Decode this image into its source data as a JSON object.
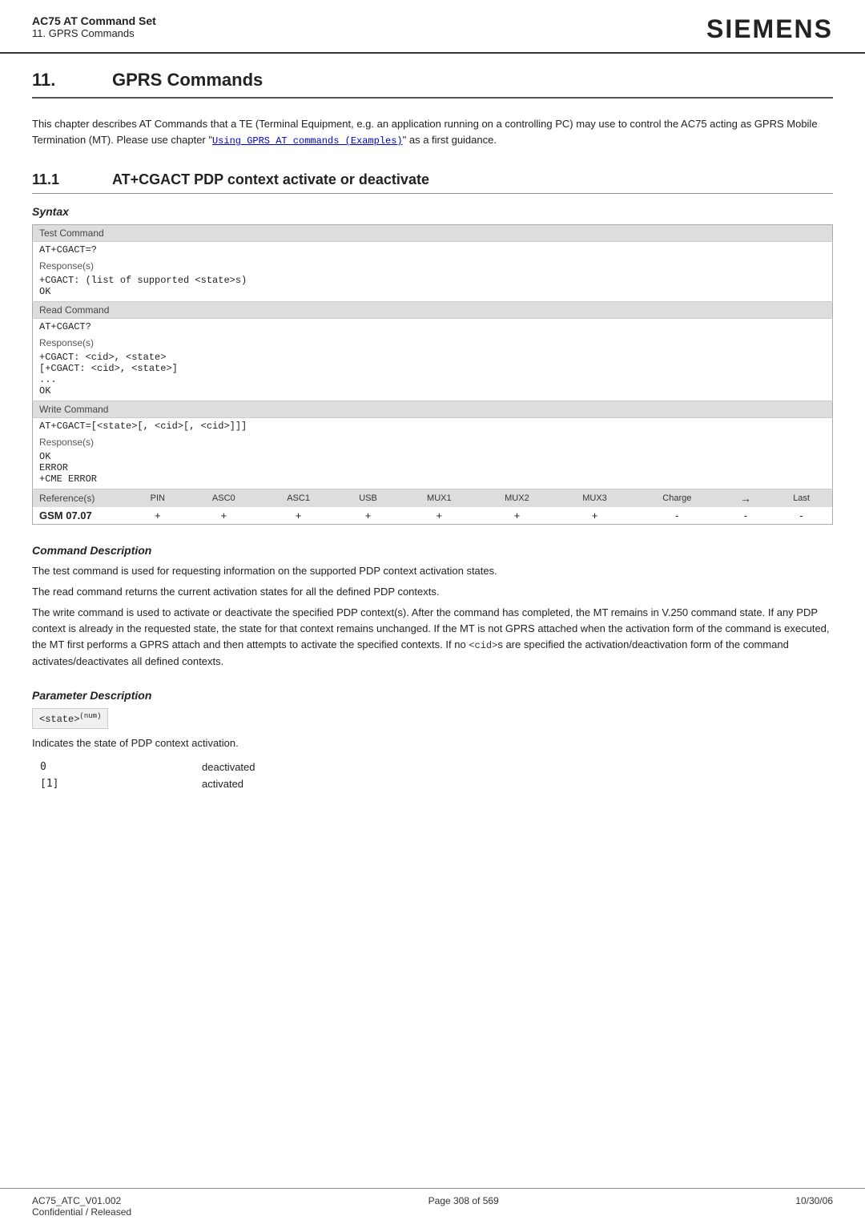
{
  "header": {
    "title": "AC75 AT Command Set",
    "subtitle": "11. GPRS Commands",
    "logo": "SIEMENS"
  },
  "chapter": {
    "number": "11.",
    "title": "GPRS Commands"
  },
  "intro": {
    "text1": "This chapter describes AT Commands that a TE (Terminal Equipment, e.g. an application running on a controlling PC) may use to control the AC75 acting as GPRS Mobile Termination (MT). Please use chapter \"",
    "link_text": "Using GPRS AT commands (Examples)",
    "text2": "\" as a first guidance."
  },
  "section": {
    "number": "11.1",
    "title": "AT+CGACT   PDP context activate or deactivate"
  },
  "syntax_label": "Syntax",
  "syntax_table": {
    "test_command": {
      "header": "Test Command",
      "command": "AT+CGACT=?",
      "response_label": "Response(s)",
      "response": "+CGACT: (list of supported <state>s)\nOK"
    },
    "read_command": {
      "header": "Read Command",
      "command": "AT+CGACT?",
      "response_label": "Response(s)",
      "response_lines": [
        "+CGACT: <cid>, <state>",
        "[+CGACT: <cid>, <state>]",
        "...",
        "OK"
      ]
    },
    "write_command": {
      "header": "Write Command",
      "command": "AT+CGACT=[<state>[, <cid>[, <cid>]]]",
      "response_label": "Response(s)",
      "response_lines": [
        "OK",
        "ERROR",
        "+CME ERROR"
      ]
    },
    "reference": {
      "header": "Reference(s)",
      "value": "GSM 07.07",
      "columns": [
        "PIN",
        "ASC0",
        "ASC1",
        "USB",
        "MUX1",
        "MUX2",
        "MUX3",
        "Charge",
        "→",
        "Last"
      ],
      "values": [
        "+",
        "+",
        "+",
        "+",
        "+",
        "+",
        "+",
        "-",
        "-",
        "-"
      ]
    }
  },
  "command_description": {
    "label": "Command Description",
    "paragraphs": [
      "The test command is used for requesting information on the supported PDP context activation states.",
      "The read command returns the current activation states for all the defined PDP contexts.",
      "The write command is used to activate or deactivate the specified PDP context(s). After the command has completed, the MT remains in V.250 command state. If any PDP context is already in the requested state, the state for that context remains unchanged. If the MT is not GPRS attached when the activation form of the command is executed, the MT first performs a GPRS attach and then attempts to activate the specified contexts. If no <cid>s are specified the activation/deactivation form of the command activates/deactivates all defined contexts."
    ]
  },
  "parameter_description": {
    "label": "Parameter Description",
    "param_name": "<state>",
    "param_type": "num",
    "param_desc": "Indicates the state of PDP context activation.",
    "values": [
      {
        "val": "0",
        "desc": "deactivated"
      },
      {
        "val": "[1]",
        "desc": "activated"
      }
    ]
  },
  "footer": {
    "left_line1": "AC75_ATC_V01.002",
    "left_line2": "Confidential / Released",
    "center": "Page 308 of 569",
    "right": "10/30/06"
  }
}
